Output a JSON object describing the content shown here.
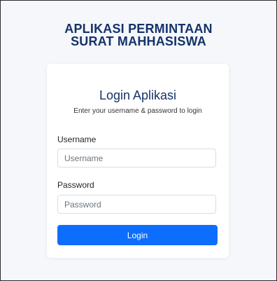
{
  "app": {
    "title_line1": "APLIKASI PERMINTAAN",
    "title_line2": "SURAT MAHHASISWA"
  },
  "login": {
    "title": "Login Aplikasi",
    "subtitle": "Enter your username & password to login",
    "username_label": "Username",
    "username_placeholder": "Username",
    "username_value": "",
    "password_label": "Password",
    "password_placeholder": "Password",
    "password_value": "",
    "submit_label": "Login"
  },
  "colors": {
    "title": "#15326b",
    "primary_button": "#0d6efd",
    "background": "#f5f7fa"
  }
}
